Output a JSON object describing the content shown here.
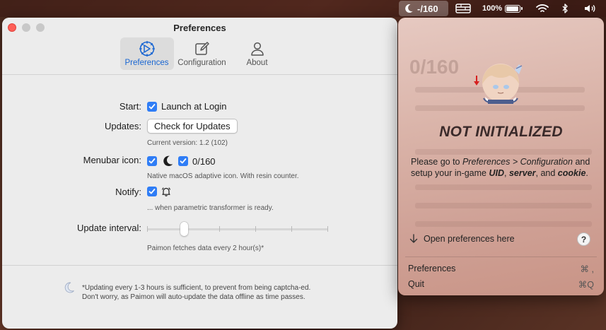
{
  "menubar": {
    "status_label": "-/160",
    "battery": "100%"
  },
  "window": {
    "title": "Preferences",
    "tabs": [
      {
        "label": "Preferences",
        "icon": "gear-icon",
        "active": true
      },
      {
        "label": "Configuration",
        "icon": "edit-icon",
        "active": false
      },
      {
        "label": "About",
        "icon": "person-icon",
        "active": false
      }
    ]
  },
  "prefs": {
    "start_label": "Start:",
    "launch_at_login": "Launch at Login",
    "launch_checked": true,
    "updates_label": "Updates:",
    "check_updates_button": "Check for Updates",
    "current_version": "Current version: 1.2 (102)",
    "menubar_icon_label": "Menubar icon:",
    "resin_counter": "0/160",
    "menubar_icon_hint": "Native macOS adaptive icon. With resin counter.",
    "notify_label": "Notify:",
    "notify_hint": "... when parametric transformer is ready.",
    "update_interval_label": "Update interval:",
    "update_interval_value": 2,
    "update_interval_hint": "Paimon fetches data every 2 hour(s)*",
    "footnote_line1": "*Updating every 1-3 hours is sufficient, to prevent from being captcha-ed.",
    "footnote_line2": "Don't worry, as Paimon will auto-update the data offline as time passes."
  },
  "panel": {
    "status_title": "NOT INITIALIZED",
    "msg_part1": "Please go to ",
    "msg_path": "Preferences > Configuration",
    "msg_part2": " and setup your in-game ",
    "msg_uid": "UID",
    "msg_comma": ", ",
    "msg_server": "server",
    "msg_and": ", and ",
    "msg_cookie": "cookie",
    "msg_end": ".",
    "open_prefs": "Open preferences here",
    "help": "?",
    "menu": [
      {
        "label": "Preferences",
        "shortcut": "⌘ ,"
      },
      {
        "label": "Quit",
        "shortcut": "⌘Q"
      }
    ],
    "ghost_counter": "0/160"
  }
}
